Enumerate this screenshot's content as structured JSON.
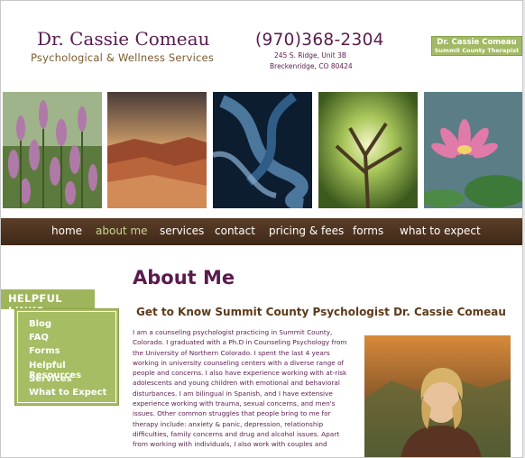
{
  "header": {
    "name": "Dr. Cassie Comeau",
    "tagline": "Psychological & Wellness Services",
    "phone": "(970)368-2304",
    "address_line1": "245 S. Ridge, Unit 3B",
    "address_line2": "Breckenridge, CO 80424",
    "badge_line1": "Dr. Cassie Comeau",
    "badge_line2": "Summit County Therapist"
  },
  "nav": {
    "items": [
      {
        "label": "home"
      },
      {
        "label": "about me"
      },
      {
        "label": "services"
      },
      {
        "label": "contact"
      },
      {
        "label": "pricing & fees"
      },
      {
        "label": "forms"
      },
      {
        "label": "what to expect"
      }
    ],
    "active": "about me",
    "active_color": "#c6d690"
  },
  "sidebar": {
    "title": "HELPFUL LINKS",
    "links": [
      "Blog",
      "FAQ",
      "Forms",
      "Helpful Resources",
      "Services",
      "What to Expect"
    ]
  },
  "main": {
    "title": "About Me",
    "subtitle": "Get to Know Summit County Psychologist Dr. Cassie Comeau",
    "bio_lines": [
      "I am a counseling psychologist practicing in Summit County,",
      "Colorado. I graduated with a Ph.D in Counseling Psychology from",
      "the University of Northern Colorado. I spent the last 4 years",
      "working in university counseling centers with a diverse range of",
      "people and concerns. I also have experience working with at-risk",
      "adolescents and young children with emotional and behavioral",
      "disturbances. I am bilingual in Spanish, and I have extensive",
      "experience working with trauma, sexual concerns, and men's",
      "issues. Other common struggles that people bring to me for",
      "therapy include: anxiety & panic, depression, relationship",
      "difficulties, family concerns and drug and alcohol issues. Apart",
      "from working with individuals, I also work with couples and"
    ]
  },
  "colors": {
    "brand_purple": "#5a1b4e",
    "accent_green": "#a2b965",
    "nav_brown": "#4a301d"
  }
}
